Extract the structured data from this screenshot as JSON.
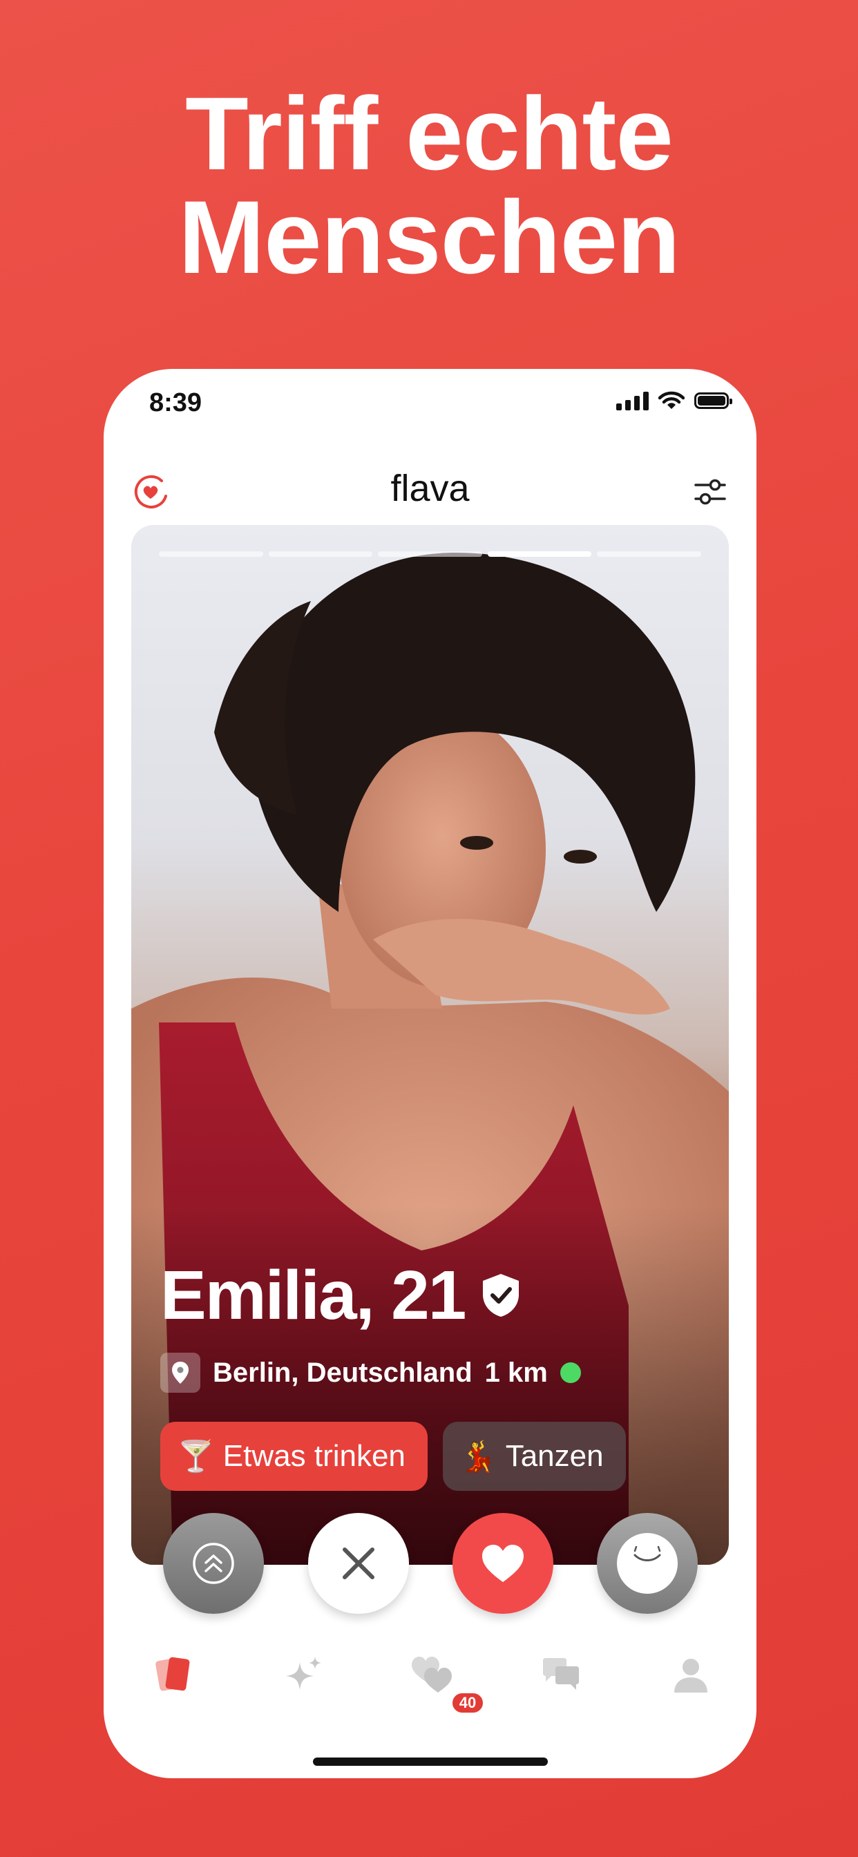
{
  "headline": {
    "line1": "Triff echte",
    "line2": "Menschen"
  },
  "status_bar": {
    "time": "8:39"
  },
  "app": {
    "brand": "flava"
  },
  "profile": {
    "name_age": "Emilia, 21",
    "location": "Berlin, Deutschland",
    "distance": "1 km",
    "online": true,
    "photo_index": 4,
    "photo_count": 5,
    "tags": [
      {
        "emoji": "🍸",
        "label": "Etwas trinken"
      },
      {
        "emoji": "💃",
        "label": "Tanzen"
      }
    ]
  },
  "tabbar": {
    "likes_badge": "40"
  },
  "colors": {
    "brand_red": "#e7413c",
    "like_button": "#f24a4a",
    "online_green": "#4cd964"
  }
}
